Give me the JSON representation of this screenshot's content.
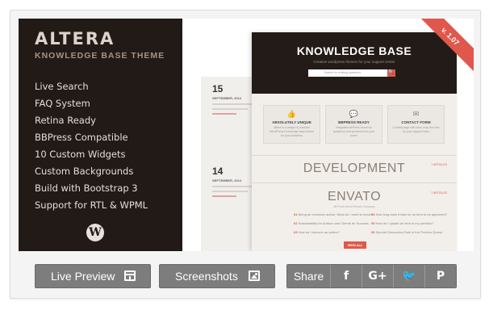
{
  "theme": {
    "title": "ALTERA",
    "subtitle": "KNOWLEDGE BASE THEME",
    "features": [
      "Live Search",
      "FAQ System",
      "Retina Ready",
      "BBPress Compatible",
      "10 Custom Widgets",
      "Custom Backgrounds",
      "Build with Bootstrap 3",
      "Support for RTL & WPML"
    ],
    "wp_logo": "W",
    "version_ribbon": "v. 1.07"
  },
  "mockup": {
    "posts": [
      {
        "day": "15",
        "month": "SEPTEMBER, 2014"
      },
      {
        "day": "14",
        "month": "SEPTEMBER, 2014"
      }
    ],
    "hero_title": "KNOWLEDGE BASE",
    "hero_tagline": "Creative wordpress themes for your support center",
    "search_placeholder": "Search for existing questions",
    "search_icon": "🔍",
    "boxes": [
      {
        "icon": "👍",
        "title": "ABSOLUTELY UNIQUE",
        "text": "Altera is a unique & powerful WordPress Knowledge base theme for your business"
      },
      {
        "icon": "💬",
        "title": "BBPRESS READY",
        "text": "Integrated bbPress forum for questions and answers from your users"
      },
      {
        "icon": "✉",
        "title": "CONTACT FORM",
        "text": "Contact page with form, map and info for your support team"
      }
    ],
    "section1_heading": "DEVELOPMENT",
    "section1_tag": "7 ARTICLES",
    "section2_heading": "ENVATO",
    "section2_tag": "7 ARTICLES",
    "section2_sub": "All Posts About Envato Company",
    "links_left": [
      "Being an exclusive author. What do I need to know?",
      "Sustainability for Authors and Clients for Success",
      "How do I become an author?"
    ],
    "links_right": [
      "How long does it take for an item to be approved?",
      "How do I update an item in my portfolio?",
      "Special Discounted Sale in the Preview Queue"
    ],
    "view_all": "VIEW ALL"
  },
  "actions": {
    "live_preview": "Live Preview",
    "screenshots": "Screenshots",
    "share": "Share",
    "facebook": "f",
    "googleplus": "G+",
    "twitter": "🐦",
    "pinterest": "P"
  }
}
